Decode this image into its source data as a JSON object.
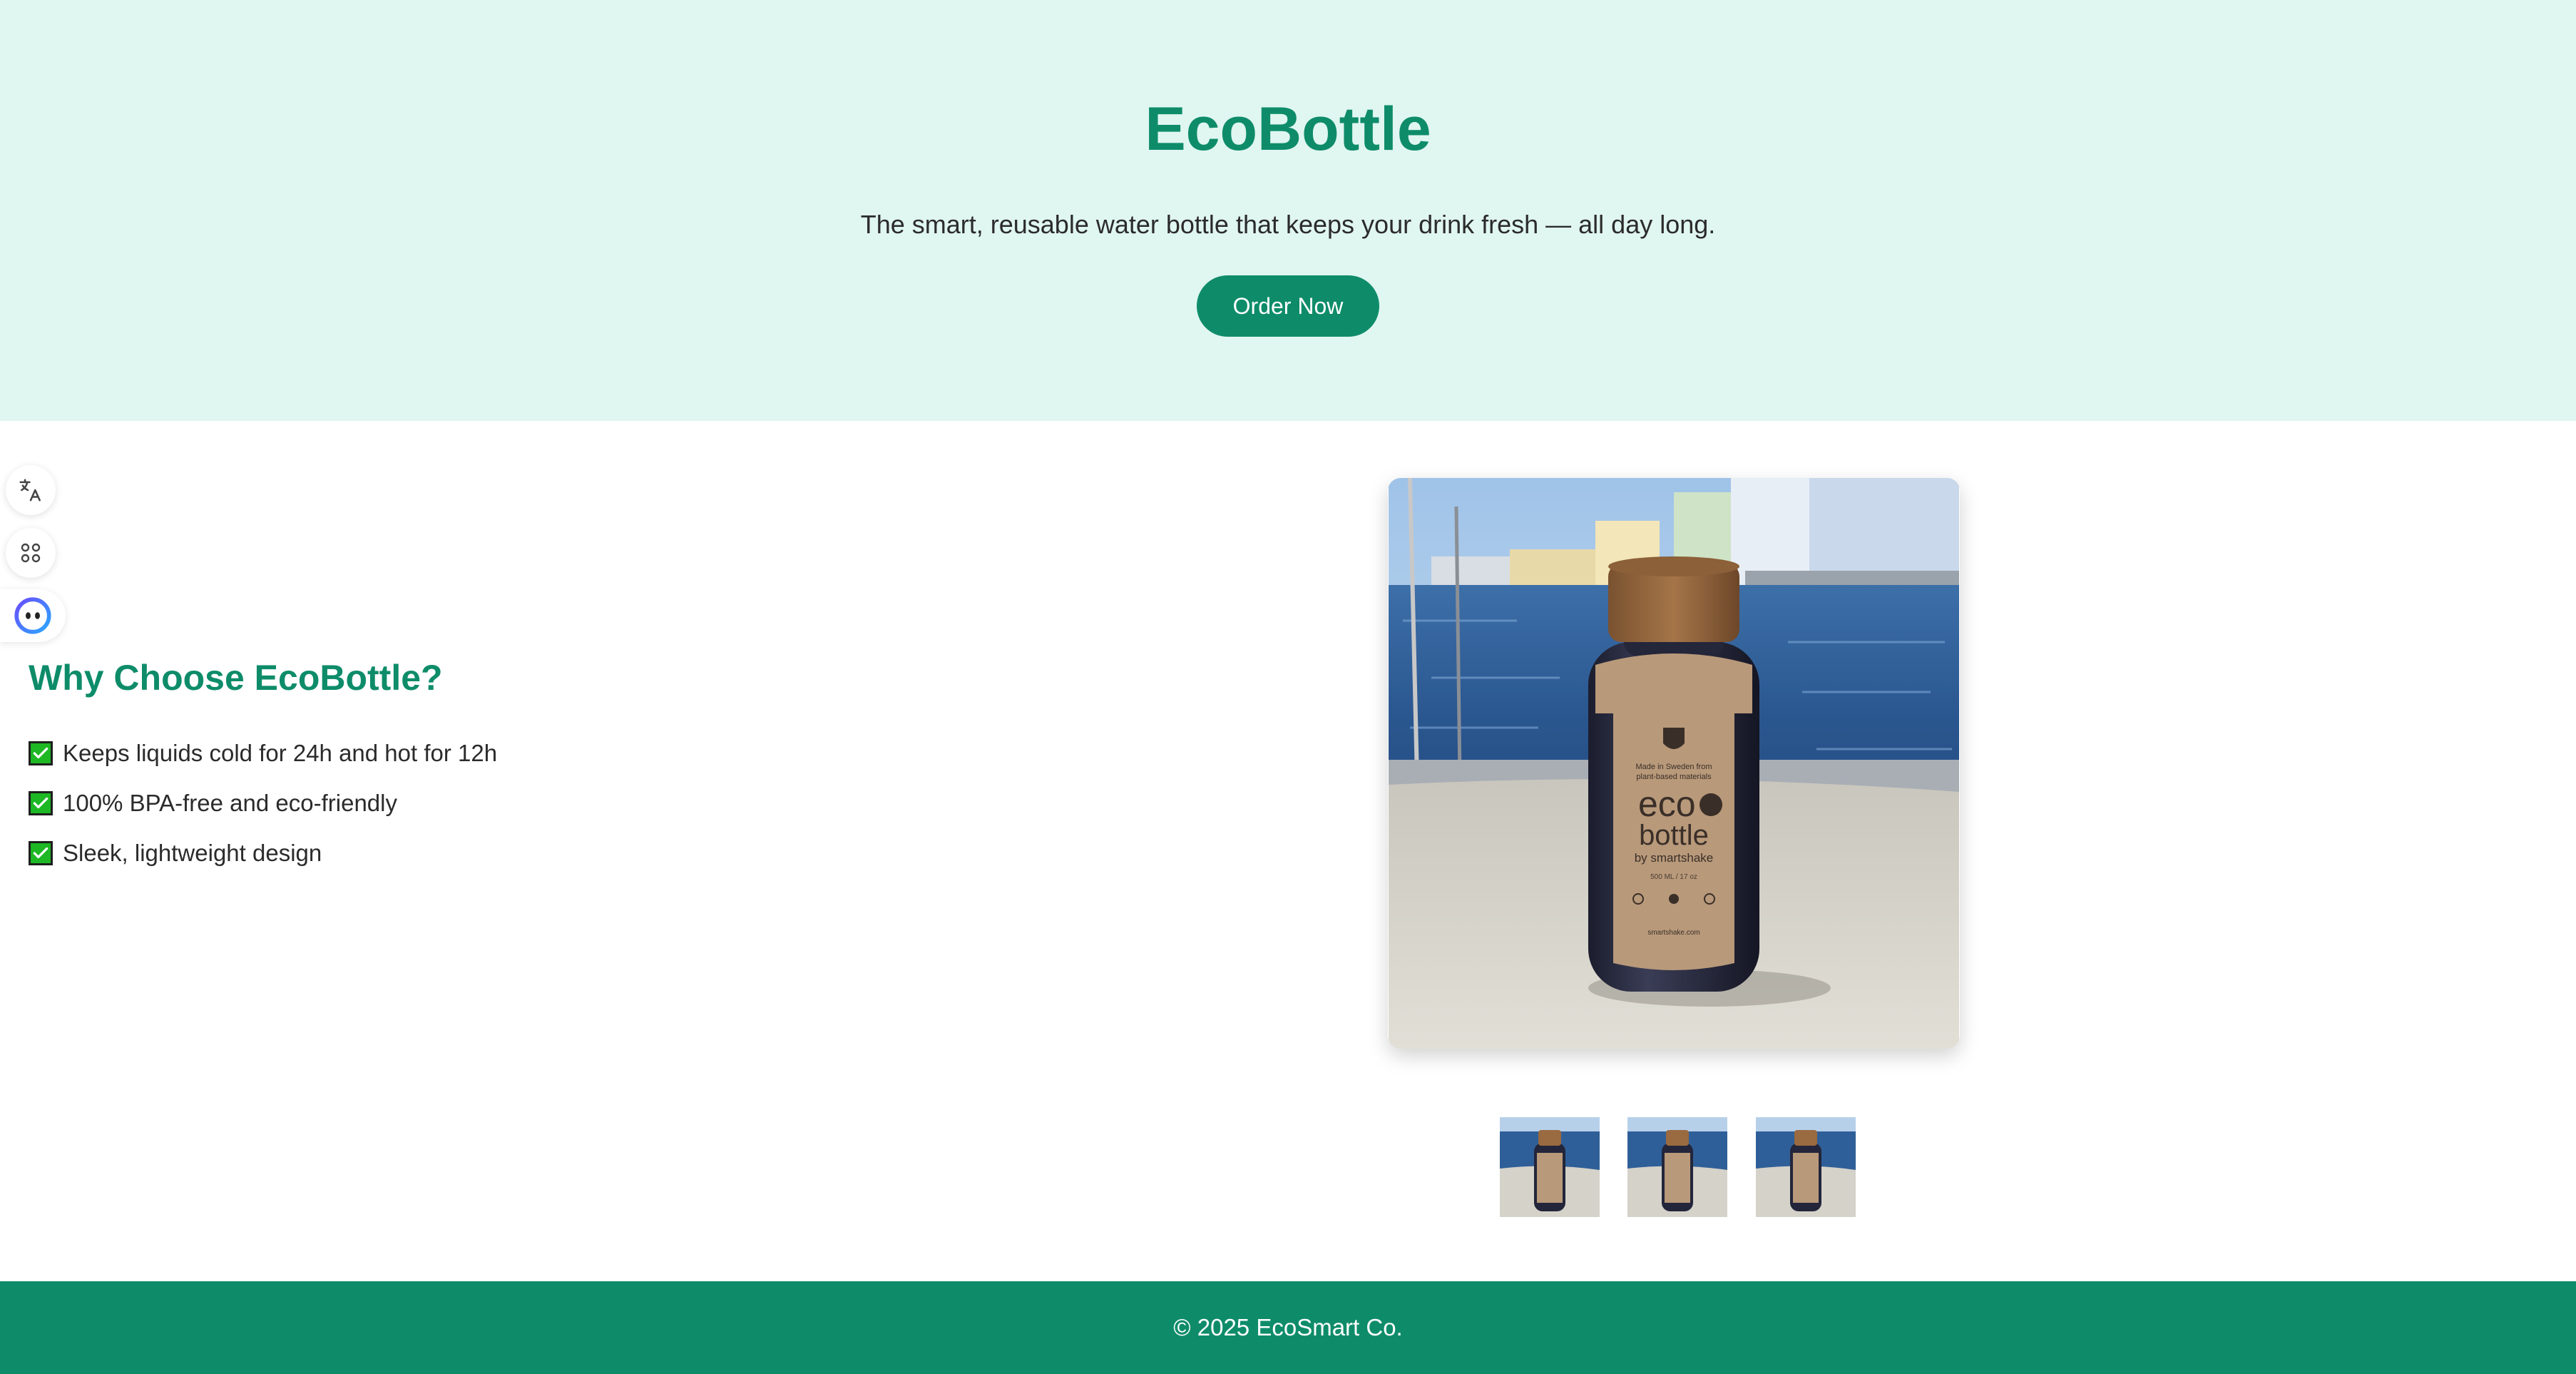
{
  "hero": {
    "title": "EcoBottle",
    "tagline": "The smart, reusable water bottle that keeps your drink fresh — all day long.",
    "cta_label": "Order Now"
  },
  "side_widgets": [
    {
      "icon": "translate-icon"
    },
    {
      "icon": "command-icon"
    },
    {
      "icon": "assistant-face-icon"
    }
  ],
  "features": {
    "title": "Why Choose EcoBottle?",
    "items": [
      {
        "icon": "checkmark-icon",
        "text": "Keeps liquids cold for 24h and hot for 12h"
      },
      {
        "icon": "checkmark-icon",
        "text": "100% BPA-free and eco-friendly"
      },
      {
        "icon": "checkmark-icon",
        "text": "Sleek, lightweight design"
      }
    ]
  },
  "product_image": {
    "label_lines": [
      "Made in Sweden from",
      "plant-based materials",
      "eco",
      "bottle",
      "by smartshake",
      "500 ML / 17 oz",
      "smartshake.com"
    ]
  },
  "thumbnails": [
    {
      "name": "thumbnail-1"
    },
    {
      "name": "thumbnail-2"
    },
    {
      "name": "thumbnail-3"
    }
  ],
  "footer": {
    "text": "© 2025 EcoSmart Co."
  },
  "colors": {
    "brand": "#0e8c6a",
    "hero_bg": "#e0f6f0",
    "text": "#2b2b2b",
    "check": "#1db824"
  }
}
